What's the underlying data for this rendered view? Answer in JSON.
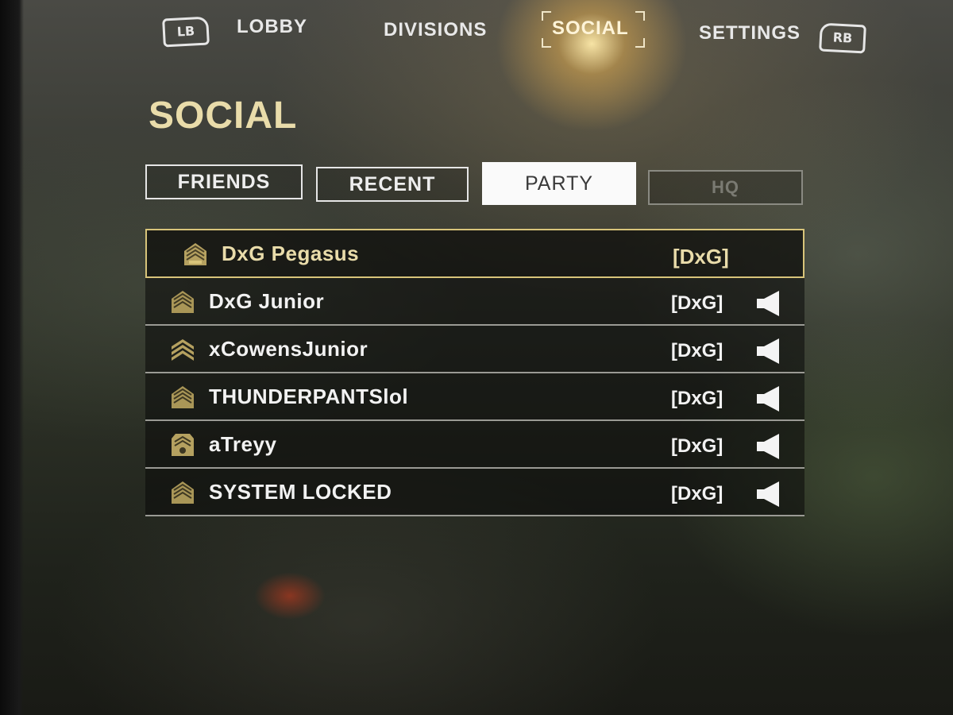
{
  "topnav": {
    "left_bumper": "LB",
    "right_bumper": "RB",
    "items": [
      {
        "label": "LOBBY",
        "active": false
      },
      {
        "label": "DIVISIONS",
        "active": false
      },
      {
        "label": "SOCIAL",
        "active": true
      },
      {
        "label": "SETTINGS",
        "active": false
      }
    ]
  },
  "page": {
    "title": "SOCIAL"
  },
  "tabs": [
    {
      "label": "FRIENDS",
      "state": "normal"
    },
    {
      "label": "RECENT",
      "state": "normal"
    },
    {
      "label": "PARTY",
      "state": "selected"
    },
    {
      "label": "HQ",
      "state": "disabled"
    }
  ],
  "party": {
    "members": [
      {
        "name": "DxG Pegasus",
        "clan": "[DxG]",
        "rank_icon": "sergeant-rank-icon",
        "speaker": false,
        "selected": true
      },
      {
        "name": "DxG Junior",
        "clan": "[DxG]",
        "rank_icon": "sergeant-rank-icon",
        "speaker": true,
        "selected": false
      },
      {
        "name": "xCowensJunior",
        "clan": "[DxG]",
        "rank_icon": "sergeant-rank-icon",
        "speaker": true,
        "selected": false
      },
      {
        "name": "THUNDERPANTSlol",
        "clan": "[DxG]",
        "rank_icon": "sergeant-rank-icon",
        "speaker": true,
        "selected": false
      },
      {
        "name": "aTreyy",
        "clan": "[DxG]",
        "rank_icon": "sergeant-rank-icon",
        "speaker": true,
        "selected": false
      },
      {
        "name": "SYSTEM LOCKED",
        "clan": "[DxG]",
        "rank_icon": "sergeant-rank-icon",
        "speaker": true,
        "selected": false
      }
    ]
  },
  "colors": {
    "accent_gold": "#e9dcaa",
    "selected_border": "#d8c47a",
    "text_primary": "#f2f2f2",
    "tab_selected_bg": "#fafafa",
    "tab_disabled": "#7a7a72"
  }
}
